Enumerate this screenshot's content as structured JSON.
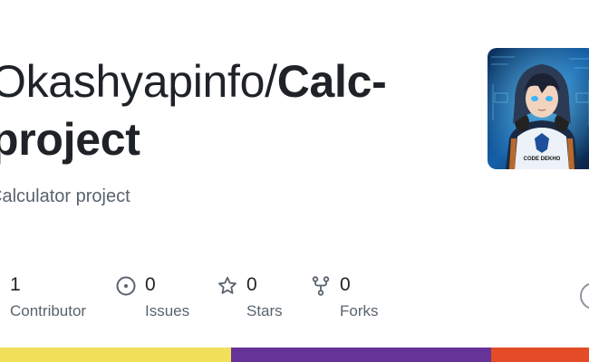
{
  "repo": {
    "owner": "Okashyapinfo/",
    "name": "Calc-project",
    "description": "Calculator project"
  },
  "stats": {
    "contributors": {
      "count": "1",
      "label": "Contributor"
    },
    "issues": {
      "count": "0",
      "label": "Issues"
    },
    "stars": {
      "count": "0",
      "label": "Stars"
    },
    "forks": {
      "count": "0",
      "label": "Forks"
    }
  },
  "avatar": {
    "badge_text": "CODE DEKHO"
  },
  "language_bar": [
    {
      "color": "#f1e05a"
    },
    {
      "color": "#663399"
    },
    {
      "color": "#e34c26"
    }
  ],
  "icons": [
    "issue-icon",
    "star-icon",
    "fork-icon",
    "avatar-icon"
  ]
}
